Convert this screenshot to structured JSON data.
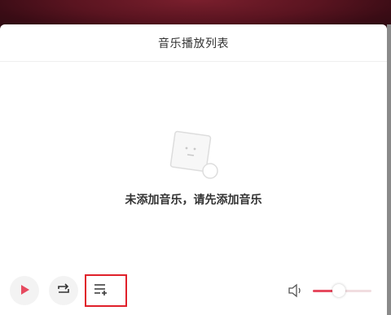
{
  "playlist": {
    "title": "音乐播放列表",
    "empty_message": "未添加音乐，请先添加音乐"
  },
  "controls": {
    "play_icon": "play-icon",
    "loop_icon": "repeat-icon",
    "add_to_list_icon": "playlist-add-icon",
    "volume_icon": "speaker-icon",
    "volume_level": 0.45
  },
  "colors": {
    "accent": "#e64a5f",
    "highlight_box": "#e0202a",
    "background_dark": "#2a0a10"
  }
}
